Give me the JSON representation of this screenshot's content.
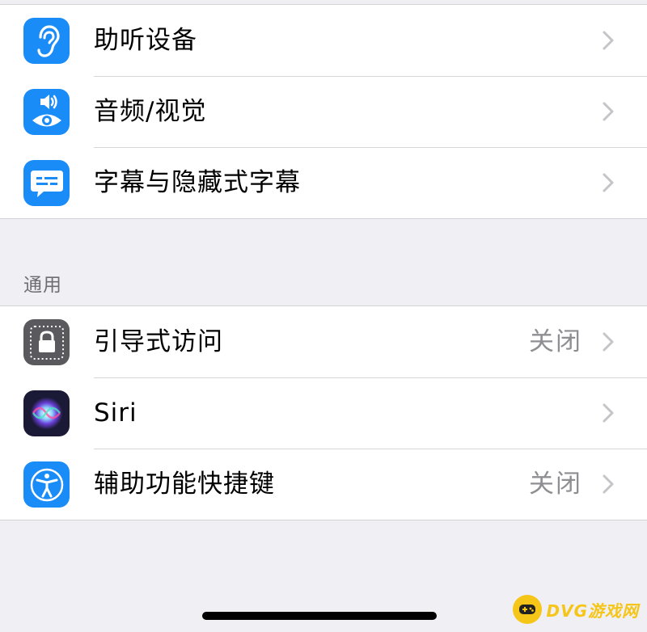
{
  "group1": {
    "items": [
      {
        "label": "助听设备",
        "icon": "ear-icon",
        "icon_color": "#1a8cf7"
      },
      {
        "label": "音频/视觉",
        "icon": "speaker-eye-icon",
        "icon_color": "#1a8cf7"
      },
      {
        "label": "字幕与隐藏式字幕",
        "icon": "caption-bubble-icon",
        "icon_color": "#1a8cf7"
      }
    ]
  },
  "section_header": "通用",
  "group2": {
    "items": [
      {
        "label": "引导式访问",
        "value": "关闭",
        "icon": "lock-icon",
        "icon_color": "#5a5a5e"
      },
      {
        "label": "Siri",
        "value": "",
        "icon": "siri-icon",
        "icon_color": "#1b1a36"
      },
      {
        "label": "辅助功能快捷键",
        "value": "关闭",
        "icon": "accessibility-icon",
        "icon_color": "#1a8cf7"
      }
    ]
  },
  "watermark": {
    "text": "DVG游戏网"
  }
}
